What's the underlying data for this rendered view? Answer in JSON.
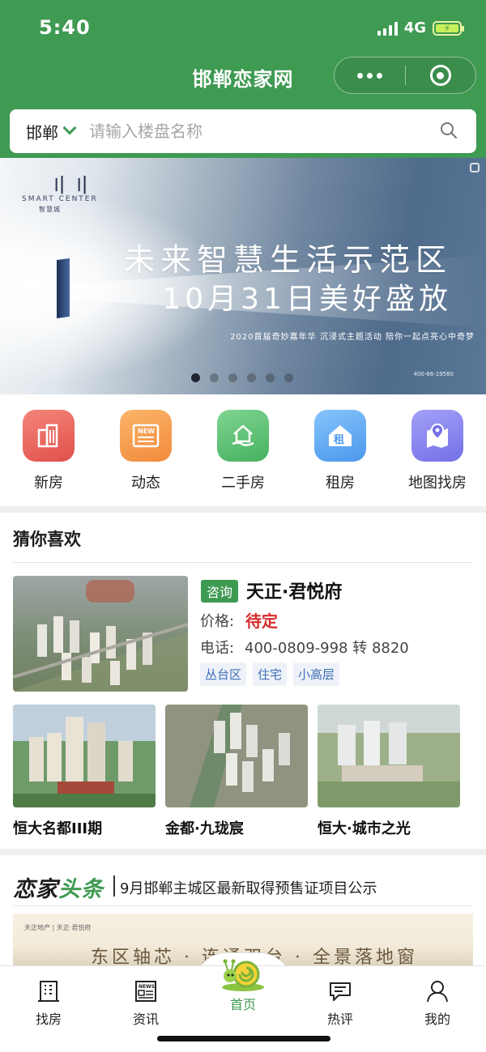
{
  "status_bar": {
    "time": "5:40",
    "network": "4G"
  },
  "header": {
    "title": "邯郸恋家网"
  },
  "search": {
    "city": "邯郸",
    "placeholder": "请输入楼盘名称"
  },
  "banner": {
    "logo_text": "SMART CENTER",
    "logo_sub": "智慧城",
    "headline_1": "未来智慧生活示范区",
    "headline_2": "10月31日美好盛放",
    "tagline": "2020首届奇妙嘉年华 沉浸式主题活动 陪你一起点亮心中奇梦",
    "hotline": "400-66-19580",
    "slide_count": 6,
    "active_slide": 1
  },
  "categories": [
    {
      "label": "新房",
      "icon": "building-icon",
      "color": "#ee6a5b"
    },
    {
      "label": "动态",
      "icon": "news-icon",
      "color": "#f7a052"
    },
    {
      "label": "二手房",
      "icon": "house-hand-icon",
      "color": "#5dc075"
    },
    {
      "label": "租房",
      "icon": "rent-house-icon",
      "color": "#5aa9f3"
    },
    {
      "label": "地图找房",
      "icon": "map-pin-icon",
      "color": "#8a86f0"
    }
  ],
  "guess": {
    "title": "猜你喜欢",
    "featured": {
      "tag": "咨询",
      "name": "天正·君悦府",
      "price_label": "价格:",
      "price": "待定",
      "phone_label": "电话:",
      "phone": "400-0809-998 转 8820",
      "tags": [
        "丛台区",
        "住宅",
        "小高层"
      ]
    },
    "items": [
      {
        "name": "恒大名都III期"
      },
      {
        "name": "金都·九珑宸"
      },
      {
        "name": "恒大·城市之光"
      }
    ]
  },
  "headlines": {
    "logo_a": "恋家",
    "logo_b": "头条",
    "text": "9月邯郸主城区最新取得预售证项目公示",
    "banner_brand": "天正地产 | 天正·君悦府",
    "banner_slogan": "东区轴芯 · 连通双台 · 全景落地窗"
  },
  "tabbar": [
    {
      "label": "找房",
      "icon": "building-outline-icon"
    },
    {
      "label": "资讯",
      "icon": "newspaper-icon"
    },
    {
      "label": "首页",
      "icon": "snail-icon",
      "active": true
    },
    {
      "label": "热评",
      "icon": "comment-icon"
    },
    {
      "label": "我的",
      "icon": "user-icon"
    }
  ],
  "colors": {
    "brand_green": "#3f9a52",
    "price_red": "#d82b2b",
    "tag_blue": "#3d6fb6"
  }
}
